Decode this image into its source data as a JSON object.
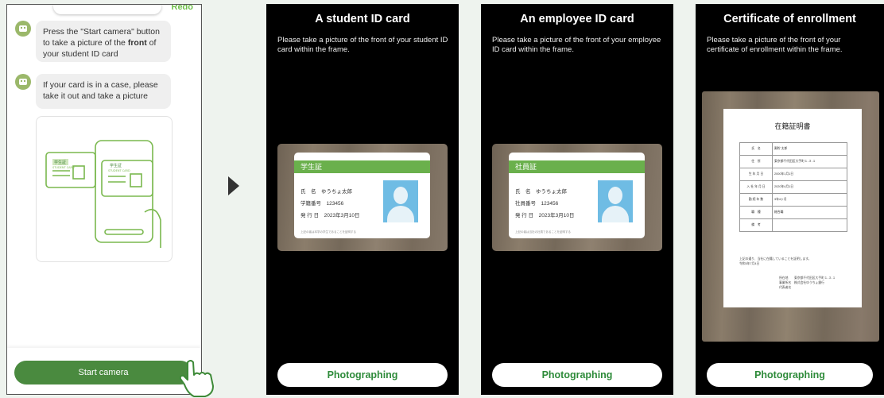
{
  "chat": {
    "redo_label": "Redo",
    "message1": "Press the \"Start camera\" button to take a picture of the front of your student ID card",
    "message2": "If your card is in a case, please take it out and take a picture",
    "illustration_card1_label": "学生証",
    "illustration_card1_sub": "STUDENT CARD",
    "illustration_card2_label": "学生証",
    "illustration_card2_sub": "STUDENT CARD",
    "start_button": "Start camera"
  },
  "panels": [
    {
      "title": "A student ID card",
      "instruction": "Please take a picture of the front of your student ID card within the frame.",
      "card": {
        "header": "学生証",
        "name_label": "氏　名",
        "name_value": "ゆうちょ太郎",
        "number_label": "学籍番号",
        "number_value": "123456",
        "date_label": "発 行 日",
        "date_value": "2023年3月10日",
        "footer": "上記の者は本学の学生であることを証明する"
      },
      "button": "Photographing"
    },
    {
      "title": "An employee ID card",
      "instruction": "Please take a picture of the front of your employee ID card within the frame.",
      "card": {
        "header": "社員証",
        "name_label": "氏　名",
        "name_value": "ゆうちょ太郎",
        "number_label": "社員番号",
        "number_value": "123456",
        "date_label": "発 行 日",
        "date_value": "2023年3月10日",
        "footer": "上記の者は当社の社員であることを証明する"
      },
      "button": "Photographing"
    },
    {
      "title": "Certificate of enrollment",
      "instruction": "Please take a picture of the front of your certificate of enrollment within the frame.",
      "document": {
        "heading": "在籍証明書",
        "rows": [
          [
            "氏　名",
            "郵貯 太郎"
          ],
          [
            "住　所",
            "東京都千代田区大手町１-３-１"
          ],
          [
            "生 年 月 日",
            "2000年1月1日"
          ],
          [
            "入 社 年 月 日",
            "2020年4月1日"
          ],
          [
            "勤 続 年 数",
            "3年4ヶ月"
          ],
          [
            "職　種",
            "総合職"
          ],
          [
            "備　考",
            ""
          ]
        ],
        "note": "上記の通り、当社に在籍していることを証明します。",
        "date": "令和5年7月4日",
        "sign1": "所在地　　東京都千代田区大手町１-３-１",
        "sign2": "事業所名　株式会社ゆうちょ銀行",
        "sign3": "代表者名"
      },
      "button": "Photographing"
    }
  ],
  "colors": {
    "accent_green": "#4a8a3f",
    "button_text_green": "#2e8b3a",
    "card_band_green": "#6ab04c",
    "portrait_blue": "#6fbce4"
  }
}
